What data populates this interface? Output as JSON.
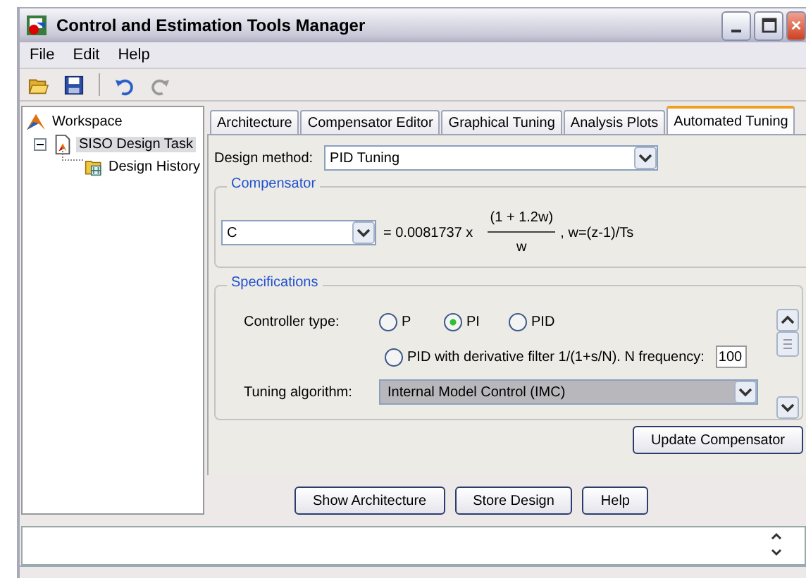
{
  "window": {
    "title": "Control and Estimation Tools Manager"
  },
  "menu": [
    "File",
    "Edit",
    "Help"
  ],
  "tree": [
    {
      "label": "Workspace",
      "selected": false,
      "children": [
        {
          "label": "SISO Design Task",
          "selected": true,
          "expanded": true,
          "children": [
            {
              "label": "Design History",
              "selected": false
            }
          ]
        }
      ]
    }
  ],
  "tabs": [
    {
      "label": "Architecture",
      "selected": false
    },
    {
      "label": "Compensator Editor",
      "selected": false
    },
    {
      "label": "Graphical Tuning",
      "selected": false
    },
    {
      "label": "Analysis Plots",
      "selected": false
    },
    {
      "label": "Automated Tuning",
      "selected": true
    }
  ],
  "design_method": {
    "label": "Design method:",
    "value": "PID Tuning"
  },
  "compensator": {
    "title": "Compensator",
    "name": "C",
    "gain": "= 0.0081737 x",
    "numerator": "(1 + 1.2w)",
    "denominator": "w",
    "suffix": ", w=(z-1)/Ts"
  },
  "specifications": {
    "title": "Specifications",
    "controller_type_label": "Controller type:",
    "options": [
      {
        "label": "P",
        "selected": false
      },
      {
        "label": "PI",
        "selected": true
      },
      {
        "label": "PID",
        "selected": false
      },
      {
        "label": "PID with derivative filter 1/(1+s/N). N frequency:",
        "selected": false
      }
    ],
    "n_frequency": "100",
    "tuning_label": "Tuning algorithm:",
    "tuning_value": "Internal Model Control (IMC)"
  },
  "update_button": "Update Compensator",
  "buttons": [
    "Show Architecture",
    "Store Design",
    "Help"
  ]
}
